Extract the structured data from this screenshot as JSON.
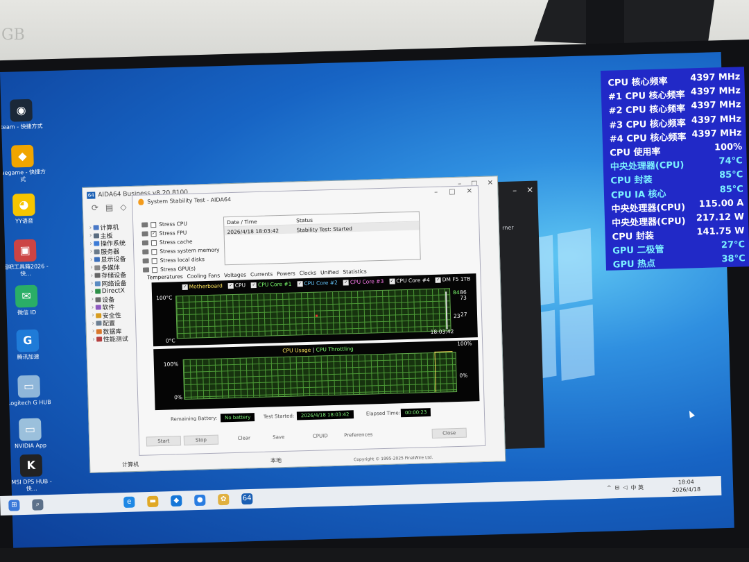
{
  "desktop": {
    "icons": [
      {
        "label": "team - 快捷方式",
        "glyph": "◉",
        "color": "#1b2838"
      },
      {
        "label": "wegame - 快捷方式",
        "glyph": "◆",
        "color": "#f0a500"
      },
      {
        "label": "YY语音",
        "glyph": "◕",
        "color": "#f6c500"
      },
      {
        "label": "图吧工具箱2026 - 快...",
        "glyph": "▣",
        "color": "#c44"
      },
      {
        "label": "微信 ID",
        "glyph": "✉",
        "color": "#2aae67"
      },
      {
        "label": "腾讯加速",
        "glyph": "G",
        "color": "#1f7bd8"
      },
      {
        "label": "Logitech G HUB",
        "glyph": "▭",
        "color": "#8fb6d9"
      },
      {
        "label": "NVIDIA App",
        "glyph": "▭",
        "color": "#9bc0dc"
      },
      {
        "label": "MSI DPS HUB - 快...",
        "glyph": "K",
        "color": "#222"
      }
    ]
  },
  "overlay": {
    "rows": [
      {
        "k": "CPU 核心频率",
        "v": "4397 MHz",
        "color": "#ffffff"
      },
      {
        "k": "#1 CPU 核心频率",
        "v": "4397 MHz",
        "color": "#ffffff"
      },
      {
        "k": "#2 CPU 核心频率",
        "v": "4397 MHz",
        "color": "#ffffff"
      },
      {
        "k": "#3 CPU 核心频率",
        "v": "4397 MHz",
        "color": "#ffffff"
      },
      {
        "k": "#4 CPU 核心频率",
        "v": "4397 MHz",
        "color": "#ffffff"
      },
      {
        "k": "CPU 使用率",
        "v": "100%",
        "color": "#ffffff"
      },
      {
        "k": "中央处理器(CPU)",
        "v": "74°C",
        "color": "#7cf0ff"
      },
      {
        "k": "CPU 封装",
        "v": "85°C",
        "color": "#7cf0ff"
      },
      {
        "k": "CPU IA 核心",
        "v": "85°C",
        "color": "#7cf0ff"
      },
      {
        "k": "中央处理器(CPU)",
        "v": "115.00 A",
        "color": "#ffffff"
      },
      {
        "k": "中央处理器(CPU)",
        "v": "217.12 W",
        "color": "#ffffff"
      },
      {
        "k": "CPU 封装",
        "v": "141.75 W",
        "color": "#ffffff"
      },
      {
        "k": "GPU 二极管",
        "v": "27°C",
        "color": "#7cf0ff"
      },
      {
        "k": "GPU 热点",
        "v": "38°C",
        "color": "#7cf0ff"
      }
    ]
  },
  "aida": {
    "title": "AIDA64 Business v8.20.8100",
    "tree": [
      {
        "label": "计算机",
        "color": "#4a79c7"
      },
      {
        "label": "主板",
        "color": "#5a6c80"
      },
      {
        "label": "操作系统",
        "color": "#3c7bd6"
      },
      {
        "label": "服务器",
        "color": "#6a7a8a"
      },
      {
        "label": "显示设备",
        "color": "#3b6fbb"
      },
      {
        "label": "多媒体",
        "color": "#888"
      },
      {
        "label": "存储设备",
        "color": "#666"
      },
      {
        "label": "网络设备",
        "color": "#5b8cc2"
      },
      {
        "label": "DirectX",
        "color": "#2d8f47"
      },
      {
        "label": "设备",
        "color": "#6b6b6b"
      },
      {
        "label": "软件",
        "color": "#8f5bc0"
      },
      {
        "label": "安全性",
        "color": "#d79c1f"
      },
      {
        "label": "配置",
        "color": "#6c7f92"
      },
      {
        "label": "数据库",
        "color": "#d9772b"
      },
      {
        "label": "性能测试",
        "color": "#b54040"
      }
    ],
    "status_left": "计算机",
    "status_mid": "本地",
    "status_right": "Copyright © 1995-2025 FinalWire Ltd."
  },
  "stability": {
    "title": "System Stability Test - AIDA64",
    "stress_items": [
      {
        "label": "Stress CPU",
        "checked": false
      },
      {
        "label": "Stress FPU",
        "checked": true
      },
      {
        "label": "Stress cache",
        "checked": false
      },
      {
        "label": "Stress system memory",
        "checked": false
      },
      {
        "label": "Stress local disks",
        "checked": false
      },
      {
        "label": "Stress GPU(s)",
        "checked": false
      }
    ],
    "log_headers": [
      "Date / Time",
      "Status"
    ],
    "log_row": [
      "2026/4/18 18:03:42",
      "Stability Test: Started"
    ],
    "tabs": [
      "Temperatures",
      "Cooling Fans",
      "Voltages",
      "Currents",
      "Powers",
      "Clocks",
      "Unified",
      "Statistics"
    ],
    "legend": [
      {
        "label": "Motherboard",
        "color": "#ffe55c"
      },
      {
        "label": "CPU",
        "color": "#ffffff"
      },
      {
        "label": "CPU Core #1",
        "color": "#7dff6e"
      },
      {
        "label": "CPU Core #2",
        "color": "#66c8ff"
      },
      {
        "label": "CPU Core #3",
        "color": "#ff7cf0"
      },
      {
        "label": "CPU Core #4",
        "color": "#ffffff"
      },
      {
        "label": "DM F5 1TB",
        "color": "#ffffff"
      }
    ],
    "temp_top": "100°C",
    "temp_bottom": "0°C",
    "temp_time": "18:03:42",
    "temp_right_values": [
      "84",
      "86",
      "73",
      "23",
      "27"
    ],
    "usage_title_a": "CPU Usage",
    "usage_sep": "|",
    "usage_title_b": "CPU Throttling",
    "usage_top": "100%",
    "usage_bottom": "0%",
    "usage_right_top": "100%",
    "usage_right_bottom": "0%",
    "remaining_battery_label": "Remaining Battery:",
    "remaining_battery_value": "No battery",
    "test_started_label": "Test Started:",
    "test_started_value": "2026/4/18 18:03:42",
    "elapsed_label": "Elapsed Time:",
    "elapsed_value": "00:00:23",
    "buttons": [
      "Start",
      "Stop",
      "Clear",
      "Save",
      "CPUID",
      "Preferences",
      "Close"
    ]
  },
  "dark_window": {
    "partial_text": "rner"
  },
  "taskbar": {
    "time": "18:04",
    "date": "2026/4/18",
    "tray_text": "中 英"
  },
  "wall": {
    "scribble": "GB"
  }
}
